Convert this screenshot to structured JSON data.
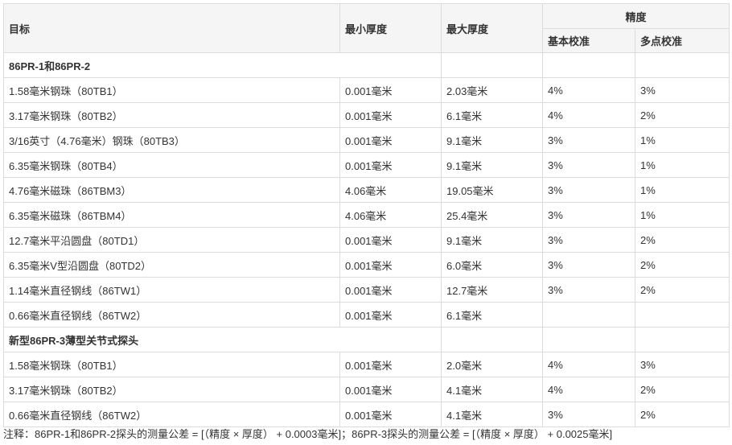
{
  "headers": {
    "target": "目标",
    "min_thickness": "最小厚度",
    "max_thickness": "最大厚度",
    "accuracy": "精度",
    "basic_calibration": "基本校准",
    "multipoint_calibration": "多点校准"
  },
  "groups": [
    {
      "title": "86PR-1和86PR-2",
      "rows": [
        {
          "target": "1.58毫米钢珠（80TB1）",
          "min": "0.001毫米",
          "max": "2.03毫米",
          "basic": "4%",
          "multi": "3%"
        },
        {
          "target": "3.17毫米钢珠（80TB2）",
          "min": "0.001毫米",
          "max": "6.1毫米",
          "basic": "4%",
          "multi": "2%"
        },
        {
          "target": "3/16英寸（4.76毫米）钢珠（80TB3）",
          "min": "0.001毫米",
          "max": "9.1毫米",
          "basic": "3%",
          "multi": "1%"
        },
        {
          "target": "6.35毫米钢珠（80TB4）",
          "min": "0.001毫米",
          "max": "9.1毫米",
          "basic": "3%",
          "multi": "1%"
        },
        {
          "target": "4.76毫米磁珠（86TBM3）",
          "min": "4.06毫米",
          "max": "19.05毫米",
          "basic": "3%",
          "multi": "1%"
        },
        {
          "target": "6.35毫米磁珠（86TBM4）",
          "min": "4.06毫米",
          "max": "25.4毫米",
          "basic": "3%",
          "multi": "1%"
        },
        {
          "target": "12.7毫米平沿圆盘（80TD1）",
          "min": "0.001毫米",
          "max": "9.1毫米",
          "basic": "3%",
          "multi": "2%"
        },
        {
          "target": "6.35毫米V型沿圆盘（80TD2）",
          "min": "0.001毫米",
          "max": "6.0毫米",
          "basic": "3%",
          "multi": "2%"
        },
        {
          "target": "1.14毫米直径钢线（86TW1）",
          "min": "0.001毫米",
          "max": "12.7毫米",
          "basic": "3%",
          "multi": "2%"
        },
        {
          "target": "0.66毫米直径钢线（86TW2）",
          "min": "0.001毫米",
          "max": "6.1毫米",
          "basic": "",
          "multi": ""
        }
      ]
    },
    {
      "title": "新型86PR-3薄型关节式探头",
      "rows": [
        {
          "target": "1.58毫米钢珠（80TB1）",
          "min": "0.001毫米",
          "max": "2.0毫米",
          "basic": "4%",
          "multi": "3%"
        },
        {
          "target": "3.17毫米钢珠（80TB2）",
          "min": "0.001毫米",
          "max": "4.1毫米",
          "basic": "4%",
          "multi": "2%"
        },
        {
          "target": "0.66毫米直径钢线（86TW2）",
          "min": "0.001毫米",
          "max": "4.1毫米",
          "basic": "3%",
          "multi": "2%"
        }
      ]
    }
  ],
  "note": "注释：86PR-1和86PR-2探头的测量公差 = [（精度 × 厚度） + 0.0003毫米]；86PR-3探头的测量公差 = [（精度 × 厚度） + 0.0025毫米]"
}
